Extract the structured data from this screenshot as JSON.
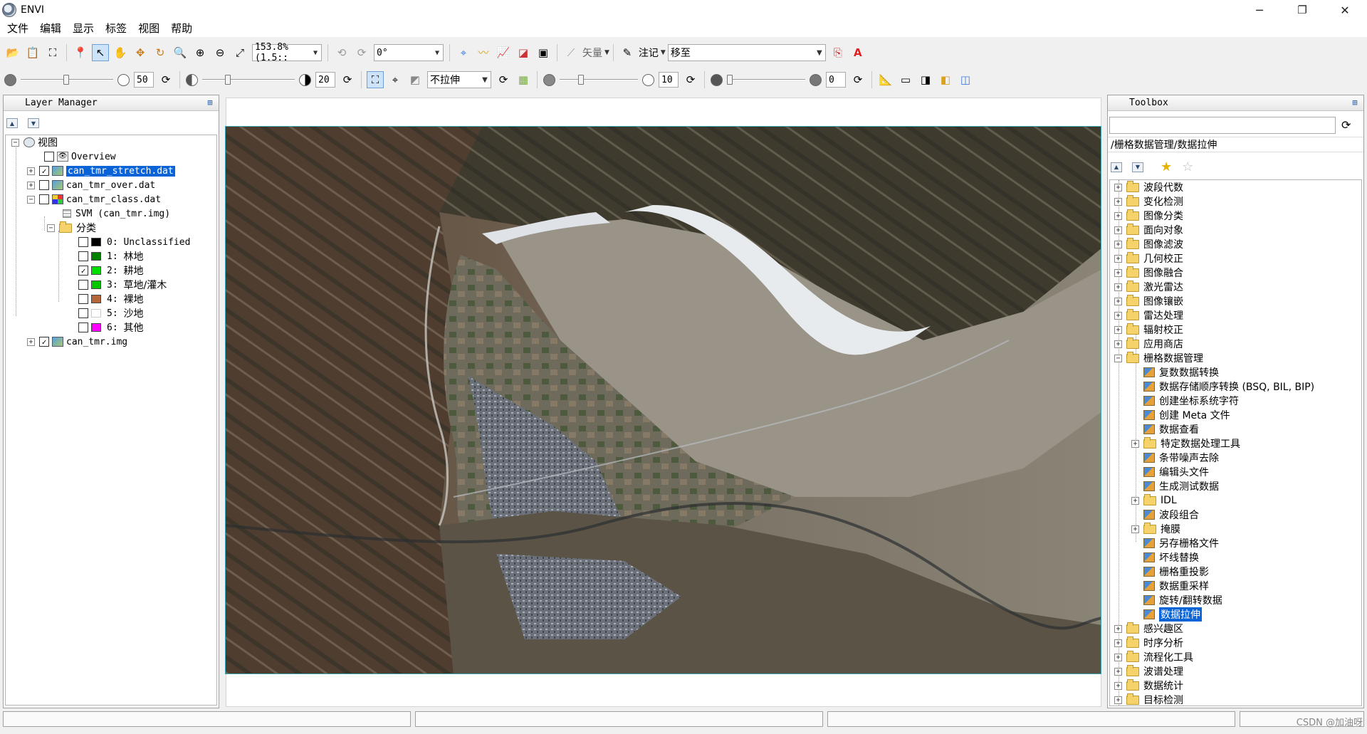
{
  "window": {
    "title": "ENVI",
    "minimize": "─",
    "restore": "❐",
    "close": "✕"
  },
  "menu": [
    "文件",
    "编辑",
    "显示",
    "标签",
    "视图",
    "帮助"
  ],
  "toolbar1": {
    "zoom_value": "153.8% (1.5::",
    "rotation_value": "0°",
    "vector_label": "矢量",
    "annotation_label": "注记",
    "goto_value": "移至"
  },
  "toolbar2": {
    "brightness_value": "50",
    "contrast_value": "20",
    "stretch_value": "不拉伸",
    "sharpen_value": "10",
    "transparency_value": "0"
  },
  "layer_manager": {
    "title": "Layer Manager",
    "view_label": "视图",
    "overview_label": "Overview",
    "layers": [
      {
        "name": "can_tmr_stretch.dat",
        "checked": true,
        "selected": true
      },
      {
        "name": "can_tmr_over.dat",
        "checked": false
      },
      {
        "name": "can_tmr_class.dat",
        "checked": false
      }
    ],
    "svm_label": "SVM (can_tmr.img)",
    "classes_label": "分类",
    "classes": [
      {
        "id": "0:",
        "name": "Unclassified",
        "color": "#000000",
        "checked": false
      },
      {
        "id": "1:",
        "name": "林地",
        "color": "#008000",
        "checked": false
      },
      {
        "id": "2:",
        "name": "耕地",
        "color": "#00e000",
        "checked": true
      },
      {
        "id": "3:",
        "name": "草地/灌木",
        "color": "#00c800",
        "checked": false
      },
      {
        "id": "4:",
        "name": "裸地",
        "color": "#b5673a",
        "checked": false
      },
      {
        "id": "5:",
        "name": "沙地",
        "color": "#ffffff",
        "checked": false
      },
      {
        "id": "6:",
        "name": "其他",
        "color": "#ff00ff",
        "checked": false
      }
    ],
    "last_layer": {
      "name": "can_tmr.img",
      "checked": true
    }
  },
  "toolbox": {
    "title": "Toolbox",
    "search_placeholder": "",
    "path": "/栅格数据管理/数据拉伸",
    "folders_top": [
      "波段代数",
      "变化检测",
      "图像分类",
      "面向对象",
      "图像滤波",
      "几何校正",
      "图像融合",
      "激光雷达",
      "图像镶嵌",
      "雷达处理",
      "辐射校正",
      "应用商店"
    ],
    "expanded_folder": "栅格数据管理",
    "children": [
      {
        "label": "复数数据转换",
        "type": "tool"
      },
      {
        "label": "数据存储顺序转换 (BSQ, BIL, BIP)",
        "type": "tool"
      },
      {
        "label": "创建坐标系统字符",
        "type": "tool"
      },
      {
        "label": "创建 Meta 文件",
        "type": "tool"
      },
      {
        "label": "数据查看",
        "type": "tool"
      },
      {
        "label": "特定数据处理工具",
        "type": "folder"
      },
      {
        "label": "条带噪声去除",
        "type": "tool"
      },
      {
        "label": "编辑头文件",
        "type": "tool"
      },
      {
        "label": "生成测试数据",
        "type": "tool"
      },
      {
        "label": "IDL",
        "type": "folder"
      },
      {
        "label": "波段组合",
        "type": "tool"
      },
      {
        "label": "掩膜",
        "type": "folder"
      },
      {
        "label": "另存栅格文件",
        "type": "tool"
      },
      {
        "label": "坏线替换",
        "type": "tool"
      },
      {
        "label": "栅格重投影",
        "type": "tool"
      },
      {
        "label": "数据重采样",
        "type": "tool"
      },
      {
        "label": "旋转/翻转数据",
        "type": "tool"
      },
      {
        "label": "数据拉伸",
        "type": "tool",
        "selected": true
      }
    ],
    "folders_bottom": [
      "感兴趣区",
      "时序分析",
      "流程化工具",
      "波谱处理",
      "数据统计",
      "目标检测"
    ]
  },
  "status": {
    "watermark": "CSDN @加油呀"
  }
}
